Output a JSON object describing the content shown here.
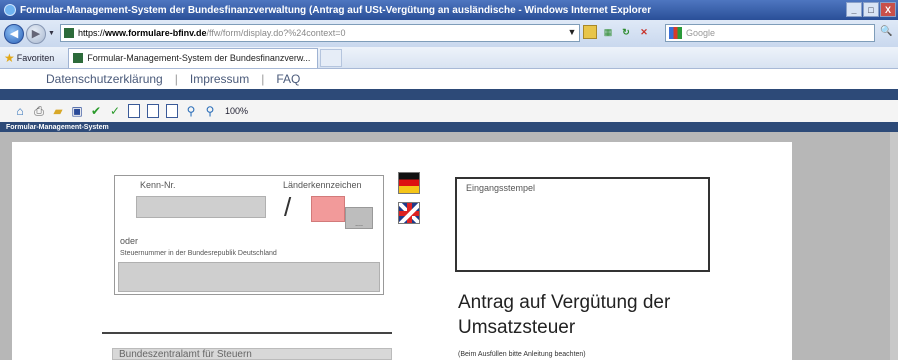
{
  "window": {
    "title": "Formular-Management-System der Bundesfinanzverwaltung (Antrag auf USt-Vergütung an ausländische - Windows Internet Explorer",
    "min": "_",
    "max": "□",
    "close": "X"
  },
  "address": {
    "scheme": "https://",
    "host": "www.formulare-bfinv.de",
    "path": "/ffw/form/display.do?%24context=0",
    "search_placeholder": "Google"
  },
  "favorites": {
    "label": "Favoriten",
    "tab_title": "Formular-Management-System der Bundesfinanzverw..."
  },
  "sitenav": {
    "links": [
      "Datenschutzerklärung",
      "Impressum",
      "FAQ"
    ],
    "separator": "|"
  },
  "toolbar": {
    "zoom": "100%"
  },
  "system_header": "Formular-Management-System",
  "form": {
    "kenn_nr_label": "Kenn-Nr.",
    "laenderkennzeichen_label": "Länderkennzeichen",
    "slash": "/",
    "oder_label": "oder",
    "steuernummer_label": "Steuernummer in der Bundesrepublik Deutschland",
    "small_button": "....",
    "eingangsstempel_label": "Eingangsstempel",
    "heading": "Antrag auf Vergütung der Umsatzsteuer",
    "office_field": "Bundeszentralamt für Steuern",
    "note": "(Beim Ausfüllen bitte Anleitung beachten)"
  }
}
